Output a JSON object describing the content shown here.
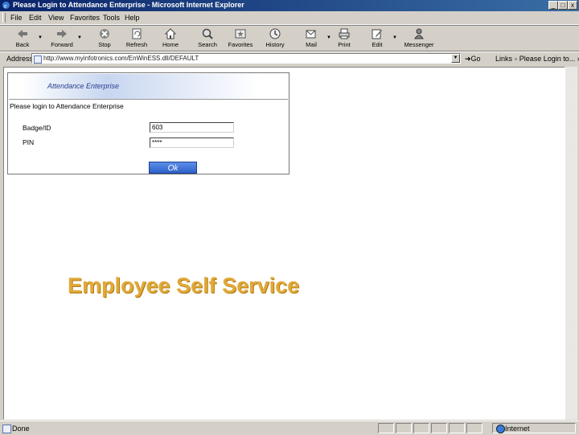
{
  "window": {
    "title": "Please Login to Attendance Enterprise - Microsoft Internet Explorer",
    "buttons": [
      "_",
      "□",
      "x"
    ]
  },
  "menu": [
    "File",
    "Edit",
    "View",
    "Favorites",
    "Tools",
    "Help"
  ],
  "toolbar": [
    {
      "label": "Back",
      "icon": "back-arrow-icon"
    },
    {
      "label": "Forward",
      "icon": "forward-arrow-icon"
    },
    {
      "label": "Stop",
      "icon": "stop-icon"
    },
    {
      "label": "Refresh",
      "icon": "refresh-icon"
    },
    {
      "label": "Home",
      "icon": "home-icon"
    },
    {
      "label": "Search",
      "icon": "search-icon"
    },
    {
      "label": "Favorites",
      "icon": "favorites-icon"
    },
    {
      "label": "History",
      "icon": "history-icon"
    },
    {
      "label": "Mail",
      "icon": "mail-icon"
    },
    {
      "label": "Print",
      "icon": "print-icon"
    },
    {
      "label": "Edit",
      "icon": "edit-icon"
    },
    {
      "label": "Messenger",
      "icon": "messenger-icon"
    }
  ],
  "address": {
    "label": "Address",
    "url": "http://www.myinfotronics.com/EnWinESS.dll/DEFAULT",
    "go": "Go",
    "links": "Links",
    "link_item": "Please Login to..."
  },
  "login": {
    "banner": "Attendance Enterprise",
    "heading": "Please login to Attendance Enterprise",
    "badge_label": "Badge/ID",
    "badge_value": "603",
    "pin_label": "PIN",
    "pin_value": "****",
    "ok": "Ok"
  },
  "page": {
    "caption": "Employee Self Service"
  },
  "status": {
    "text": "Done",
    "zone": "Internet"
  },
  "colors": {
    "titlebar": "#0a246a",
    "caption": "#e0a93a",
    "ok_button": "#2f62c9"
  }
}
